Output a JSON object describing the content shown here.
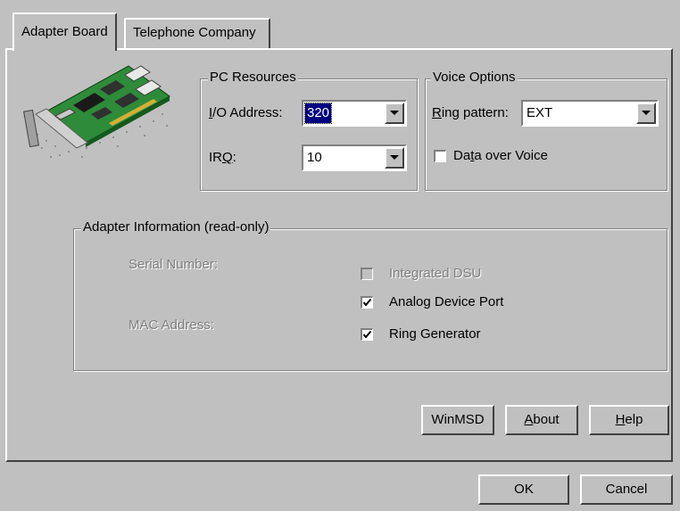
{
  "tabs": [
    {
      "label": "Adapter Board",
      "active": true
    },
    {
      "label": "Telephone Company",
      "active": false
    }
  ],
  "pc_resources": {
    "legend": "PC Resources",
    "io_label_underlined": "I",
    "io_label_rest": "/O Address:",
    "io_value": "320",
    "irq_label_prefix": "IR",
    "irq_label_underlined": "Q",
    "irq_label_suffix": ":",
    "irq_value": "10"
  },
  "voice_options": {
    "legend": "Voice Options",
    "ring_label_underlined": "R",
    "ring_label_rest": "ing pattern:",
    "ring_value": "EXT",
    "data_over_voice_prefix": "Da",
    "data_over_voice_underlined": "t",
    "data_over_voice_suffix": "a over Voice",
    "data_over_voice_checked": false
  },
  "adapter_info": {
    "legend": "Adapter Information (read-only)",
    "serial_label": "Serial Number:",
    "mac_label": "MAC Address:",
    "integrated_dsu": {
      "label": "Integrated DSU",
      "checked": false,
      "enabled": false
    },
    "analog_device_port": {
      "label": "Analog Device Port",
      "checked": true
    },
    "ring_generator": {
      "label": "Ring Generator",
      "checked": true
    }
  },
  "panel_buttons": {
    "winmsd": "WinMSD",
    "about_underlined": "A",
    "about_rest": "bout",
    "help_underlined": "H",
    "help_rest": "elp"
  },
  "dialog_buttons": {
    "ok": "OK",
    "cancel": "Cancel"
  },
  "icons": [
    "adapter-board-icon",
    "dropdown-arrow-icon",
    "checkmark-icon"
  ],
  "colors": {
    "face": "#c0c0c0",
    "selection": "#000080",
    "shadow": "#808080",
    "highlight": "#ffffff"
  }
}
